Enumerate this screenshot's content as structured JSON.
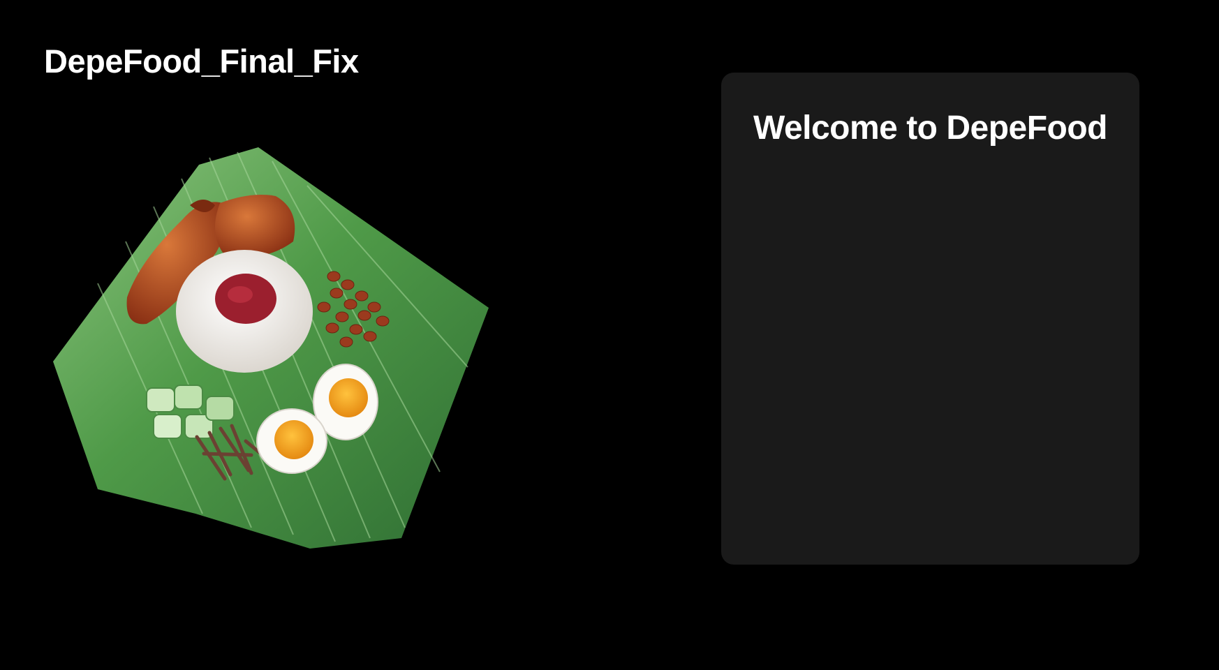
{
  "app": {
    "title": "DepeFood_Final_Fix"
  },
  "hero": {
    "icon": "nasi-lemak-illustration"
  },
  "welcome_card": {
    "heading": "Welcome to DepeFood"
  },
  "colors": {
    "background": "#000000",
    "card": "#1a1a1a",
    "text": "#ffffff"
  }
}
